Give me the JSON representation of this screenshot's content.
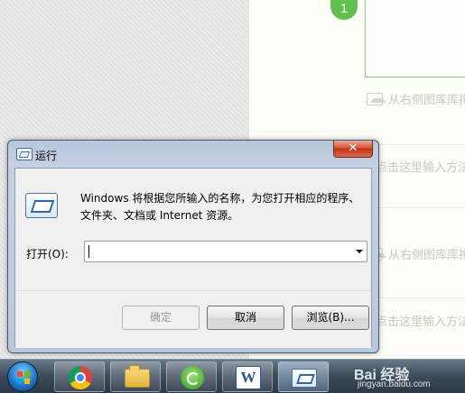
{
  "editor": {
    "step_number": "1",
    "hint_image": "从右侧图库库拖动",
    "hint_input": "点击这里输入方法",
    "hint_image_2": "从右侧图库库拖动",
    "hint_input_2": "点击这里输入方法"
  },
  "dialog": {
    "title": "运行",
    "close_glyph": "✕",
    "description": "Windows 将根据您所输入的名称，为您打开相应的程序、文件夹、文档或 Internet 资源。",
    "open_label": "打开(O):",
    "input_value": "",
    "ok_label": "确定",
    "cancel_label": "取消",
    "browse_label": "浏览(B)..."
  },
  "taskbar": {
    "word_letter": "W"
  },
  "watermark": {
    "brand": "Bai 经验",
    "url": "jingyan.baidu.com"
  }
}
